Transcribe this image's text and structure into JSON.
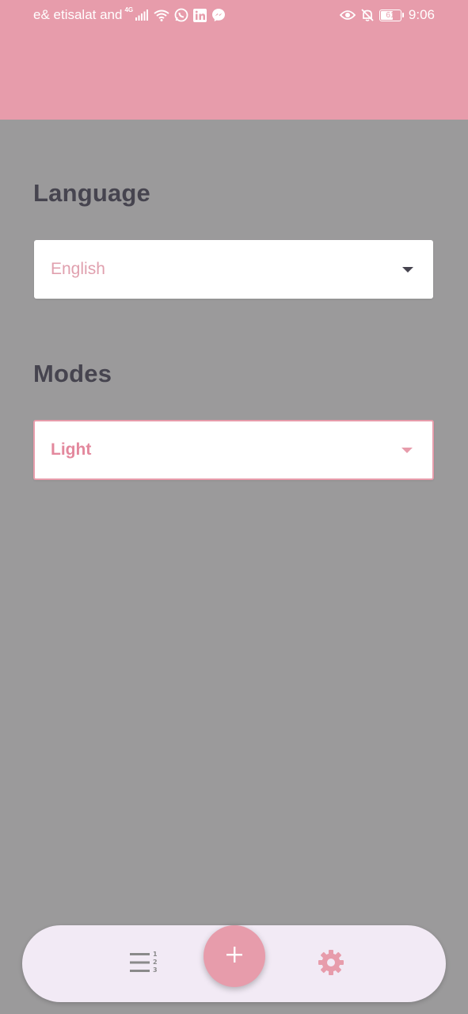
{
  "status_bar": {
    "carrier": "e& etisalat and",
    "network_type": "4G",
    "battery_level": "61",
    "time": "9:06",
    "icons": [
      "signal-icon",
      "wifi-icon",
      "whatsapp-icon",
      "linkedin-icon",
      "messenger-icon",
      "eye-comfort-icon",
      "notifications-off-icon",
      "battery-icon"
    ]
  },
  "settings": {
    "language": {
      "title": "Language",
      "selected": "English"
    },
    "modes": {
      "title": "Modes",
      "selected": "Light"
    }
  },
  "bottom_nav": {
    "items": [
      {
        "icon": "numbered-list-icon"
      },
      {
        "icon": "add-icon"
      },
      {
        "icon": "settings-gear-icon"
      }
    ]
  },
  "colors": {
    "accent": "#e79cab",
    "background": "#9b9a9b",
    "title_text": "#46444f",
    "nav_background": "#f2eaf5",
    "list_icon": "#8a8a8a"
  }
}
